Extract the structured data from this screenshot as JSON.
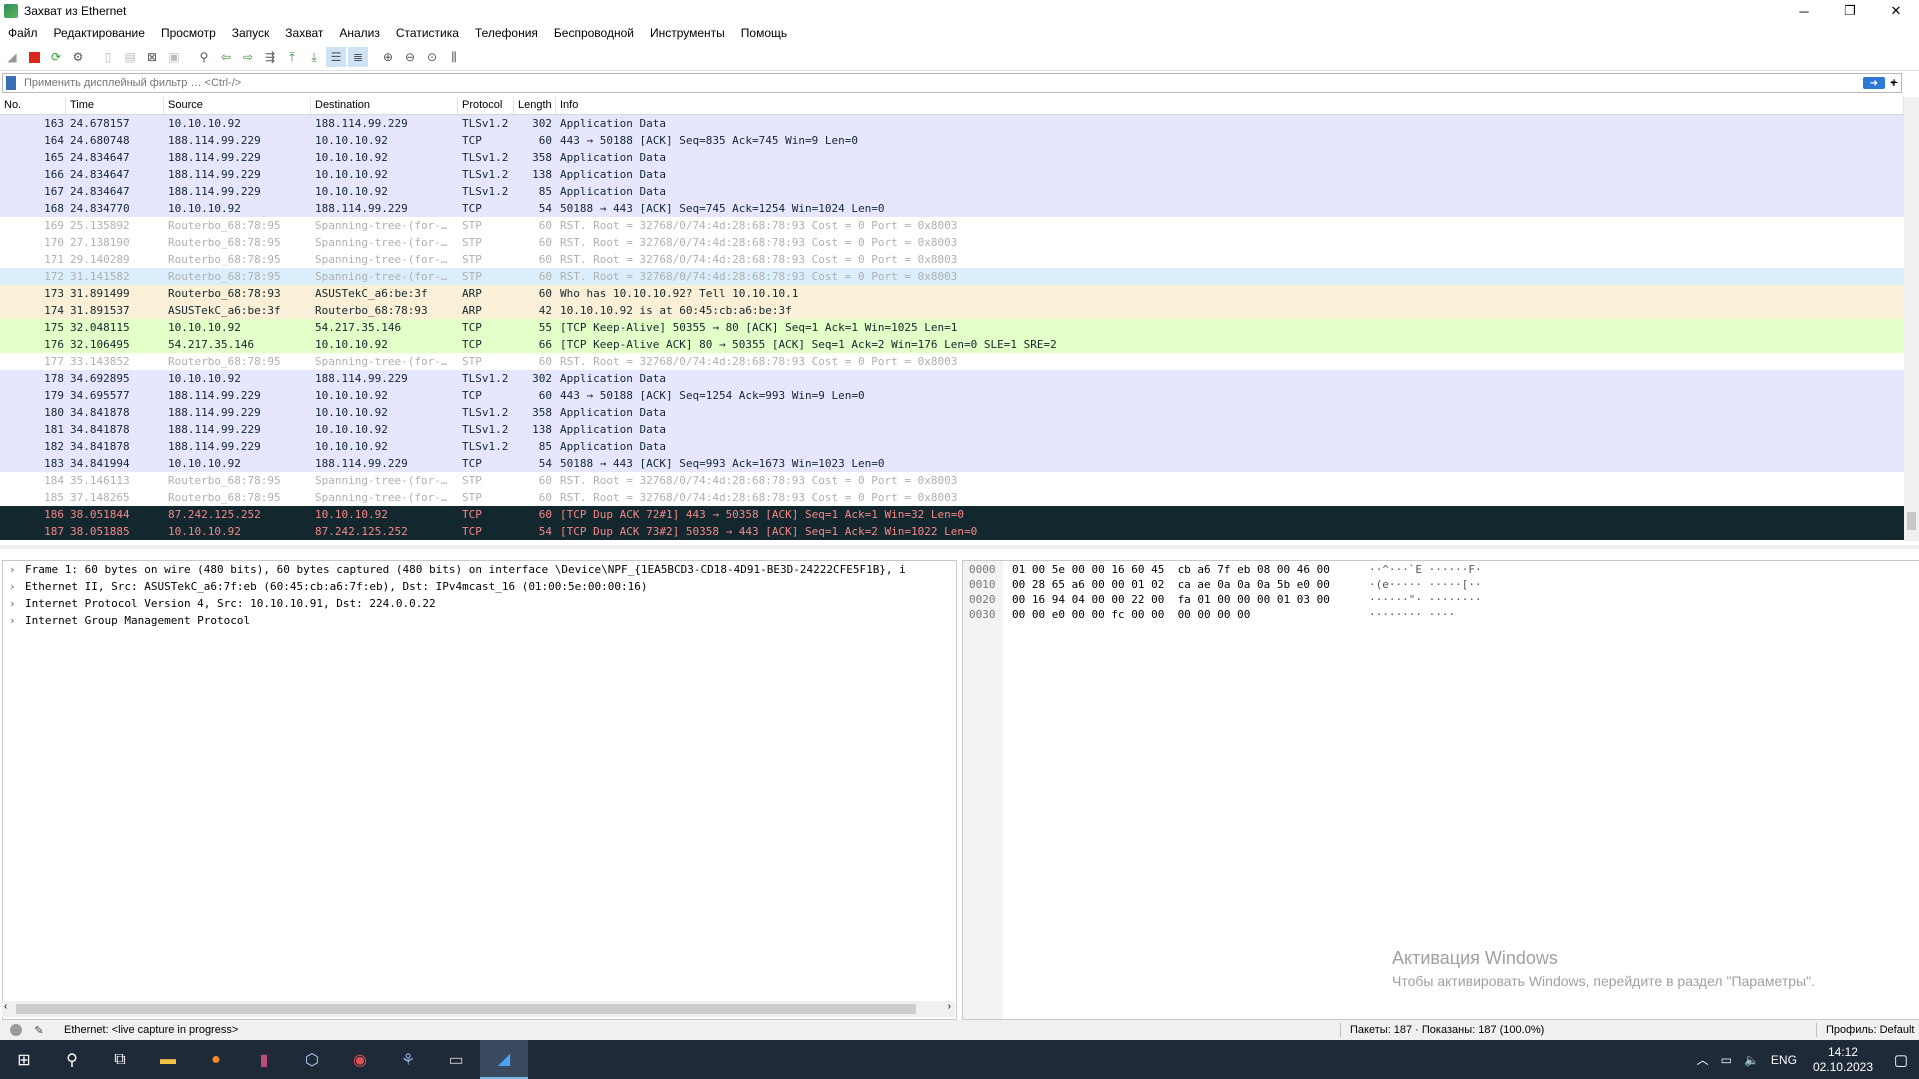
{
  "window": {
    "title": "Захват из Ethernet"
  },
  "menu": [
    "Файл",
    "Редактирование",
    "Просмотр",
    "Запуск",
    "Захват",
    "Анализ",
    "Статистика",
    "Телефония",
    "Беспроводной",
    "Инструменты",
    "Помощь"
  ],
  "filter": {
    "placeholder": "Применить дисплейный фильтр … <Ctrl-/>"
  },
  "columns": [
    "No.",
    "Time",
    "Source",
    "Destination",
    "Protocol",
    "Length",
    "Info"
  ],
  "colors": {
    "tls_tcp": "#e7e6ff",
    "stp": "#fffffe",
    "arp": "#faf0d7",
    "keepalive": "#e4ffc7",
    "selected_bad": "#12272e",
    "bad_text": "#f78787"
  },
  "packets": [
    {
      "no": "163",
      "time": "24.678157",
      "src": "10.10.10.92",
      "dst": "188.114.99.229",
      "proto": "TLSv1.2",
      "len": "302",
      "info": "Application Data",
      "cls": "tls_tcp"
    },
    {
      "no": "164",
      "time": "24.680748",
      "src": "188.114.99.229",
      "dst": "10.10.10.92",
      "proto": "TCP",
      "len": "60",
      "info": "443 → 50188 [ACK] Seq=835 Ack=745 Win=9 Len=0",
      "cls": "tls_tcp"
    },
    {
      "no": "165",
      "time": "24.834647",
      "src": "188.114.99.229",
      "dst": "10.10.10.92",
      "proto": "TLSv1.2",
      "len": "358",
      "info": "Application Data",
      "cls": "tls_tcp"
    },
    {
      "no": "166",
      "time": "24.834647",
      "src": "188.114.99.229",
      "dst": "10.10.10.92",
      "proto": "TLSv1.2",
      "len": "138",
      "info": "Application Data",
      "cls": "tls_tcp"
    },
    {
      "no": "167",
      "time": "24.834647",
      "src": "188.114.99.229",
      "dst": "10.10.10.92",
      "proto": "TLSv1.2",
      "len": "85",
      "info": "Application Data",
      "cls": "tls_tcp"
    },
    {
      "no": "168",
      "time": "24.834770",
      "src": "10.10.10.92",
      "dst": "188.114.99.229",
      "proto": "TCP",
      "len": "54",
      "info": "50188 → 443 [ACK] Seq=745 Ack=1254 Win=1024 Len=0",
      "cls": "tls_tcp"
    },
    {
      "no": "169",
      "time": "25.135892",
      "src": "Routerbo_68:78:95",
      "dst": "Spanning-tree-(for-…",
      "proto": "STP",
      "len": "60",
      "info": "RST. Root = 32768/0/74:4d:28:68:78:93  Cost = 0  Port = 0x8003",
      "cls": "stp"
    },
    {
      "no": "170",
      "time": "27.138190",
      "src": "Routerbo_68:78:95",
      "dst": "Spanning-tree-(for-…",
      "proto": "STP",
      "len": "60",
      "info": "RST. Root = 32768/0/74:4d:28:68:78:93  Cost = 0  Port = 0x8003",
      "cls": "stp"
    },
    {
      "no": "171",
      "time": "29.140289",
      "src": "Routerbo_68:78:95",
      "dst": "Spanning-tree-(for-…",
      "proto": "STP",
      "len": "60",
      "info": "RST. Root = 32768/0/74:4d:28:68:78:93  Cost = 0  Port = 0x8003",
      "cls": "stp"
    },
    {
      "no": "172",
      "time": "31.141582",
      "src": "Routerbo_68:78:95",
      "dst": "Spanning-tree-(for-…",
      "proto": "STP",
      "len": "60",
      "info": "RST. Root = 32768/0/74:4d:28:68:78:93  Cost = 0  Port = 0x8003",
      "cls": "stp_hl"
    },
    {
      "no": "173",
      "time": "31.891499",
      "src": "Routerbo_68:78:93",
      "dst": "ASUSTekC_a6:be:3f",
      "proto": "ARP",
      "len": "60",
      "info": "Who has 10.10.10.92? Tell 10.10.10.1",
      "cls": "arp"
    },
    {
      "no": "174",
      "time": "31.891537",
      "src": "ASUSTekC_a6:be:3f",
      "dst": "Routerbo_68:78:93",
      "proto": "ARP",
      "len": "42",
      "info": "10.10.10.92 is at 60:45:cb:a6:be:3f",
      "cls": "arp"
    },
    {
      "no": "175",
      "time": "32.048115",
      "src": "10.10.10.92",
      "dst": "54.217.35.146",
      "proto": "TCP",
      "len": "55",
      "info": "[TCP Keep-Alive] 50355 → 80 [ACK] Seq=1 Ack=1 Win=1025 Len=1",
      "cls": "keepalive"
    },
    {
      "no": "176",
      "time": "32.106495",
      "src": "54.217.35.146",
      "dst": "10.10.10.92",
      "proto": "TCP",
      "len": "66",
      "info": "[TCP Keep-Alive ACK] 80 → 50355 [ACK] Seq=1 Ack=2 Win=176 Len=0 SLE=1 SRE=2",
      "cls": "keepalive"
    },
    {
      "no": "177",
      "time": "33.143852",
      "src": "Routerbo_68:78:95",
      "dst": "Spanning-tree-(for-…",
      "proto": "STP",
      "len": "60",
      "info": "RST. Root = 32768/0/74:4d:28:68:78:93  Cost = 0  Port = 0x8003",
      "cls": "stp"
    },
    {
      "no": "178",
      "time": "34.692895",
      "src": "10.10.10.92",
      "dst": "188.114.99.229",
      "proto": "TLSv1.2",
      "len": "302",
      "info": "Application Data",
      "cls": "tls_tcp"
    },
    {
      "no": "179",
      "time": "34.695577",
      "src": "188.114.99.229",
      "dst": "10.10.10.92",
      "proto": "TCP",
      "len": "60",
      "info": "443 → 50188 [ACK] Seq=1254 Ack=993 Win=9 Len=0",
      "cls": "tls_tcp"
    },
    {
      "no": "180",
      "time": "34.841878",
      "src": "188.114.99.229",
      "dst": "10.10.10.92",
      "proto": "TLSv1.2",
      "len": "358",
      "info": "Application Data",
      "cls": "tls_tcp"
    },
    {
      "no": "181",
      "time": "34.841878",
      "src": "188.114.99.229",
      "dst": "10.10.10.92",
      "proto": "TLSv1.2",
      "len": "138",
      "info": "Application Data",
      "cls": "tls_tcp"
    },
    {
      "no": "182",
      "time": "34.841878",
      "src": "188.114.99.229",
      "dst": "10.10.10.92",
      "proto": "TLSv1.2",
      "len": "85",
      "info": "Application Data",
      "cls": "tls_tcp"
    },
    {
      "no": "183",
      "time": "34.841994",
      "src": "10.10.10.92",
      "dst": "188.114.99.229",
      "proto": "TCP",
      "len": "54",
      "info": "50188 → 443 [ACK] Seq=993 Ack=1673 Win=1023 Len=0",
      "cls": "tls_tcp"
    },
    {
      "no": "184",
      "time": "35.146113",
      "src": "Routerbo_68:78:95",
      "dst": "Spanning-tree-(for-…",
      "proto": "STP",
      "len": "60",
      "info": "RST. Root = 32768/0/74:4d:28:68:78:93  Cost = 0  Port = 0x8003",
      "cls": "stp"
    },
    {
      "no": "185",
      "time": "37.148265",
      "src": "Routerbo_68:78:95",
      "dst": "Spanning-tree-(for-…",
      "proto": "STP",
      "len": "60",
      "info": "RST. Root = 32768/0/74:4d:28:68:78:93  Cost = 0  Port = 0x8003",
      "cls": "stp"
    },
    {
      "no": "186",
      "time": "38.051844",
      "src": "87.242.125.252",
      "dst": "10.10.10.92",
      "proto": "TCP",
      "len": "60",
      "info": "[TCP Dup ACK 72#1] 443 → 50358 [ACK] Seq=1 Ack=1 Win=32 Len=0",
      "cls": "bad"
    },
    {
      "no": "187",
      "time": "38.051885",
      "src": "10.10.10.92",
      "dst": "87.242.125.252",
      "proto": "TCP",
      "len": "54",
      "info": "[TCP Dup ACK 73#2] 50358 → 443 [ACK] Seq=1 Ack=2 Win=1022 Len=0",
      "cls": "bad"
    }
  ],
  "details": [
    "Frame 1: 60 bytes on wire (480 bits), 60 bytes captured (480 bits) on interface \\Device\\NPF_{1EA5BCD3-CD18-4D91-BE3D-24222CFE5F1B}, i",
    "Ethernet II, Src: ASUSTekC_a6:7f:eb (60:45:cb:a6:7f:eb), Dst: IPv4mcast_16 (01:00:5e:00:00:16)",
    "Internet Protocol Version 4, Src: 10.10.10.91, Dst: 224.0.0.22",
    "Internet Group Management Protocol"
  ],
  "bytes": [
    {
      "off": "0000",
      "hex": "01 00 5e 00 00 16 60 45  cb a6 7f eb 08 00 46 00",
      "ascii": "··^···`E ······F·"
    },
    {
      "off": "0010",
      "hex": "00 28 65 a6 00 00 01 02  ca ae 0a 0a 0a 5b e0 00",
      "ascii": "·(e····· ·····[··"
    },
    {
      "off": "0020",
      "hex": "00 16 94 04 00 00 22 00  fa 01 00 00 00 01 03 00",
      "ascii": "······\"· ········"
    },
    {
      "off": "0030",
      "hex": "00 00 e0 00 00 fc 00 00  00 00 00 00",
      "ascii": "········ ····"
    }
  ],
  "watermark": {
    "line1": "Активация Windows",
    "line2": "Чтобы активировать Windows, перейдите в раздел \"Параметры\"."
  },
  "status": {
    "interface": "Ethernet: <live capture in progress>",
    "packets": "Пакеты: 187 · Показаны: 187 (100.0%)",
    "profile": "Профиль: Default"
  },
  "taskbar": {
    "lang": "ENG",
    "time": "14:12",
    "date": "02.10.2023"
  }
}
